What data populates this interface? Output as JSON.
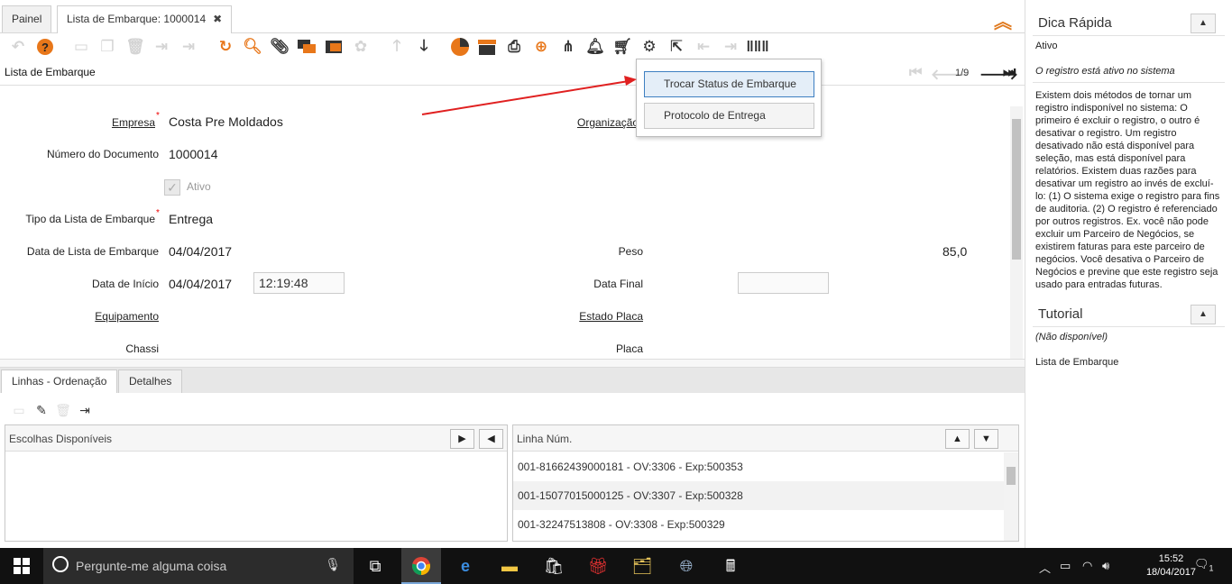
{
  "tabs": {
    "painel": "Painel",
    "lista": "Lista de Embarque: 1000014",
    "close": "✖"
  },
  "window": {
    "title": "Lista de Embarque",
    "record_nav": "1/9"
  },
  "popup": {
    "item1": "Trocar Status de Embarque",
    "item2": "Protocolo de Entrega"
  },
  "form": {
    "empresa_label": "Empresa",
    "empresa_value": "Costa Pre Moldados",
    "organizacao_label": "Organização",
    "numero_label": "Número do Documento",
    "numero_value": "1000014",
    "ativo_label": "Ativo",
    "ativo_checked": true,
    "tipo_label": "Tipo da Lista de Embarque",
    "tipo_value": "Entrega",
    "data_lista_label": "Data de Lista de Embarque",
    "data_lista_value": "04/04/2017",
    "peso_label": "Peso",
    "peso_value": "85,0",
    "data_inicio_label": "Data de Início",
    "data_inicio_value": "04/04/2017",
    "hora_inicio_value": "12:19:48",
    "data_final_label": "Data Final",
    "data_final_value": "",
    "equipamento_label": "Equipamento",
    "estado_placa_label": "Estado Placa",
    "chassi_label": "Chassi",
    "placa_label": "Placa"
  },
  "subtabs": {
    "linhas": "Linhas - Ordenação",
    "detalhes": "Detalhes"
  },
  "left_panel": {
    "header": "Escolhas Disponíveis"
  },
  "right_panel": {
    "header": "Linha Núm.",
    "rows": [
      "001-81662439000181 - OV:3306 - Exp:500353",
      "001-15077015000125 - OV:3307 - Exp:500328",
      "001-32247513808 - OV:3308 - Exp:500329"
    ]
  },
  "sidebar": {
    "dica_title": "Dica Rápida",
    "field_name": "Ativo",
    "field_desc": "O registro está ativo no sistema",
    "help_text": "Existem dois métodos de tornar um registro indisponível no sistema: O primeiro é excluir o registro, o outro é desativar o registro. Um registro desativado não está disponível para seleção, mas está disponível para relatórios. Existem duas razões para desativar um registro ao invés de excluí-lo: (1) O sistema exige o registro para fins de auditoria. (2) O registro é referenciado por outros registros. Ex. você não pode excluir um Parceiro de Negócios, se existirem faturas para este parceiro de negócios. Você desativa o Parceiro de Negócios e previne que este registro seja usado para entradas futuras.",
    "tutorial_title": "Tutorial",
    "tutorial_status": "(Não disponível)",
    "tutorial_item": "Lista de Embarque"
  },
  "taskbar": {
    "search_placeholder": "Pergunte-me alguma coisa",
    "time": "15:52",
    "date": "18/04/2017",
    "notif_count": "1"
  },
  "colors": {
    "accent": "#e8771a",
    "arrow": "#e02020",
    "selection_border": "#3d7fc1"
  }
}
